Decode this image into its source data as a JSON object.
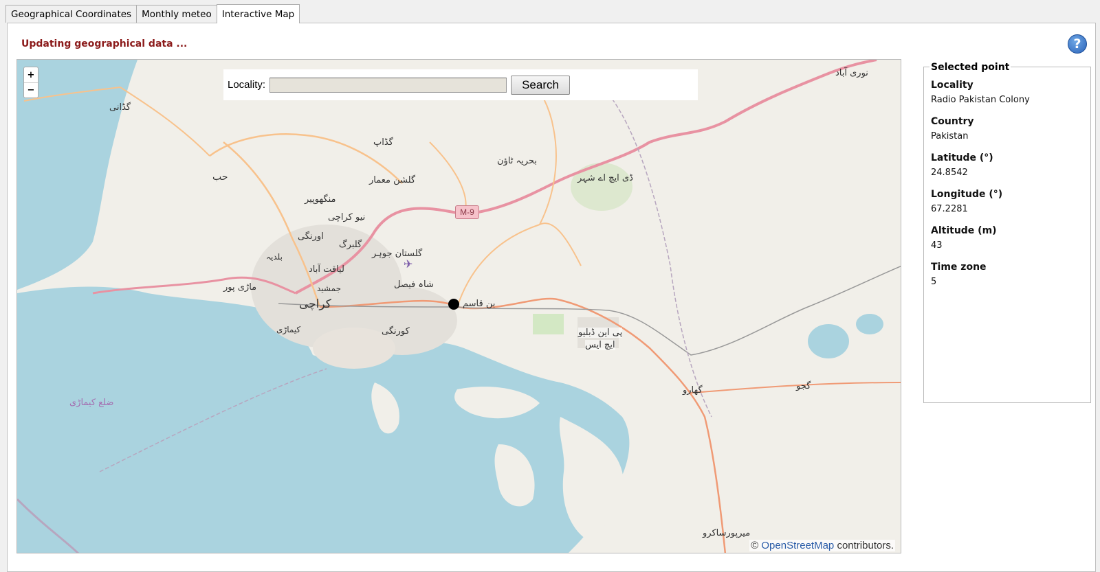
{
  "tabs": [
    {
      "label": "Geographical Coordinates"
    },
    {
      "label": "Monthly meteo"
    },
    {
      "label": "Interactive Map"
    }
  ],
  "status": "Updating geographical data ...",
  "help_icon": "question-circle-icon",
  "map": {
    "zoom_in": "+",
    "zoom_out": "−",
    "search": {
      "label": "Locality:",
      "value": "",
      "button": "Search"
    },
    "attribution": {
      "prefix": "©",
      "link": "OpenStreetMap",
      "suffix": "contributors."
    },
    "road_badge": "M-9",
    "labels": [
      "نوری آباد",
      "گڈانی",
      "گڈاپ",
      "بحریہ ٹاؤن",
      "ڈی ایچ اے شہر",
      "حب",
      "گلشن معمار",
      "منگھوپیر",
      "نیو کراچی",
      "اورنگی",
      "گلبرگ",
      "گلستان جوہر",
      "بلدیہ",
      "لیاقت آباد",
      "شاہ فیصل",
      "ماڑی پور",
      "جمشید",
      "کراچی",
      "بن قاسم",
      "کیماڑی",
      "کورنگی",
      "پی این ڈبلیو",
      "ایچ ایس",
      "گجو",
      "گھارو",
      "ضلع کیماڑی",
      "میرپورساکرو"
    ]
  },
  "selected_point": {
    "title": "Selected point",
    "fields": [
      {
        "label": "Locality",
        "value": "Radio Pakistan Colony"
      },
      {
        "label": "Country",
        "value": "Pakistan"
      },
      {
        "label": "Latitude (°)",
        "value": "24.8542"
      },
      {
        "label": "Longitude (°)",
        "value": "67.2281"
      },
      {
        "label": "Altitude (m)",
        "value": "43"
      },
      {
        "label": "Time zone",
        "value": "5"
      }
    ]
  },
  "colors": {
    "status": "#8b1a1a",
    "sea": "#aad3df",
    "land": "#f1efe9",
    "motorway": "#e892a2",
    "primary": "#f8c28c"
  }
}
